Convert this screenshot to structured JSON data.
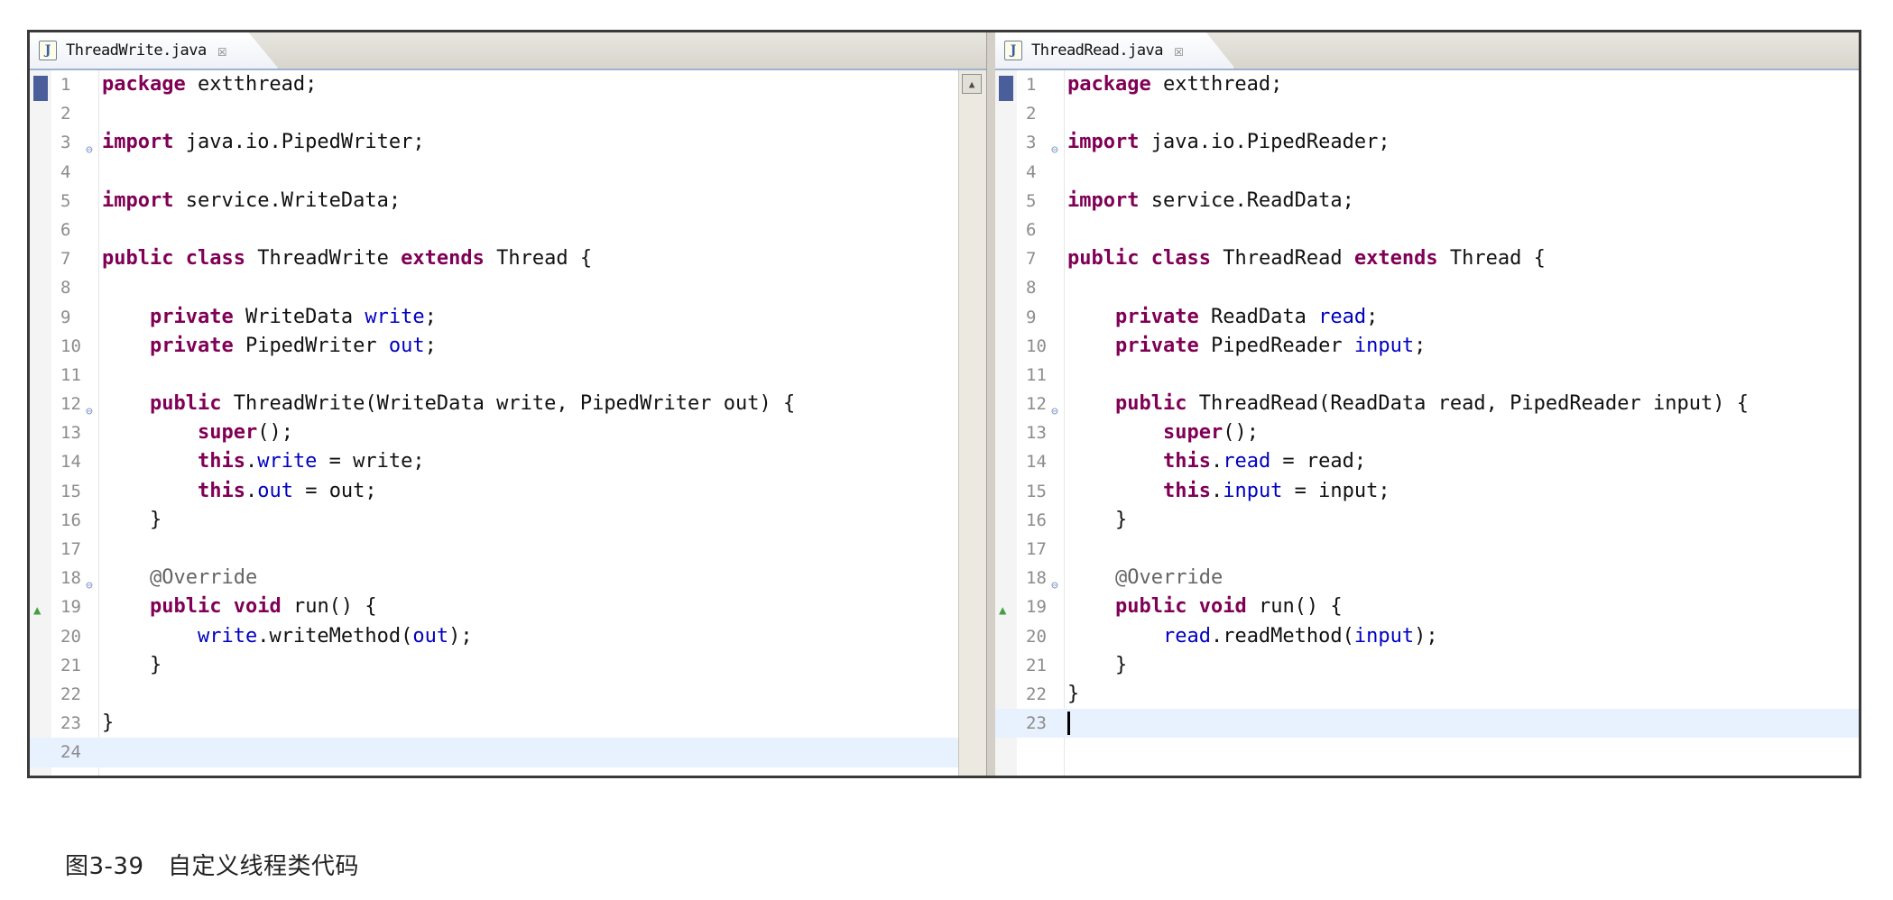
{
  "left_editor": {
    "tab_title": "ThreadWrite.java",
    "lines": [
      {
        "n": "1",
        "tokens": [
          {
            "t": "package",
            "c": "kw"
          },
          {
            "t": " extthread;"
          }
        ]
      },
      {
        "n": "2",
        "tokens": []
      },
      {
        "n": "3",
        "fold": true,
        "tokens": [
          {
            "t": "import",
            "c": "kw"
          },
          {
            "t": " java.io.PipedWriter;"
          }
        ]
      },
      {
        "n": "4",
        "tokens": []
      },
      {
        "n": "5",
        "tokens": [
          {
            "t": "import",
            "c": "kw"
          },
          {
            "t": " service.WriteData;"
          }
        ]
      },
      {
        "n": "6",
        "tokens": []
      },
      {
        "n": "7",
        "tokens": [
          {
            "t": "public",
            "c": "kw"
          },
          {
            "t": " "
          },
          {
            "t": "class",
            "c": "kw"
          },
          {
            "t": " ThreadWrite "
          },
          {
            "t": "extends",
            "c": "kw"
          },
          {
            "t": " Thread {"
          }
        ]
      },
      {
        "n": "8",
        "tokens": []
      },
      {
        "n": "9",
        "tokens": [
          {
            "t": "    "
          },
          {
            "t": "private",
            "c": "kw"
          },
          {
            "t": " WriteData "
          },
          {
            "t": "write",
            "c": "fld"
          },
          {
            "t": ";"
          }
        ]
      },
      {
        "n": "10",
        "tokens": [
          {
            "t": "    "
          },
          {
            "t": "private",
            "c": "kw"
          },
          {
            "t": " PipedWriter "
          },
          {
            "t": "out",
            "c": "fld"
          },
          {
            "t": ";"
          }
        ]
      },
      {
        "n": "11",
        "tokens": []
      },
      {
        "n": "12",
        "fold": true,
        "tokens": [
          {
            "t": "    "
          },
          {
            "t": "public",
            "c": "kw"
          },
          {
            "t": " ThreadWrite(WriteData write, PipedWriter out) {"
          }
        ]
      },
      {
        "n": "13",
        "tokens": [
          {
            "t": "        "
          },
          {
            "t": "super",
            "c": "kw"
          },
          {
            "t": "();"
          }
        ]
      },
      {
        "n": "14",
        "tokens": [
          {
            "t": "        "
          },
          {
            "t": "this",
            "c": "kw"
          },
          {
            "t": "."
          },
          {
            "t": "write",
            "c": "fld"
          },
          {
            "t": " = write;"
          }
        ]
      },
      {
        "n": "15",
        "tokens": [
          {
            "t": "        "
          },
          {
            "t": "this",
            "c": "kw"
          },
          {
            "t": "."
          },
          {
            "t": "out",
            "c": "fld"
          },
          {
            "t": " = out;"
          }
        ]
      },
      {
        "n": "16",
        "tokens": [
          {
            "t": "    }"
          }
        ]
      },
      {
        "n": "17",
        "tokens": []
      },
      {
        "n": "18",
        "fold": true,
        "tokens": [
          {
            "t": "    "
          },
          {
            "t": "@Override",
            "c": "ann"
          }
        ]
      },
      {
        "n": "19",
        "arrow": true,
        "tokens": [
          {
            "t": "    "
          },
          {
            "t": "public",
            "c": "kw"
          },
          {
            "t": " "
          },
          {
            "t": "void",
            "c": "kw"
          },
          {
            "t": " run() {"
          }
        ]
      },
      {
        "n": "20",
        "tokens": [
          {
            "t": "        "
          },
          {
            "t": "write",
            "c": "fld"
          },
          {
            "t": ".writeMethod("
          },
          {
            "t": "out",
            "c": "fld"
          },
          {
            "t": ");"
          }
        ]
      },
      {
        "n": "21",
        "tokens": [
          {
            "t": "    }"
          }
        ]
      },
      {
        "n": "22",
        "tokens": []
      },
      {
        "n": "23",
        "tokens": [
          {
            "t": "}"
          }
        ]
      },
      {
        "n": "24",
        "current": true,
        "tokens": []
      }
    ]
  },
  "right_editor": {
    "tab_title": "ThreadRead.java",
    "lines": [
      {
        "n": "1",
        "tokens": [
          {
            "t": "package",
            "c": "kw"
          },
          {
            "t": " extthread;"
          }
        ]
      },
      {
        "n": "2",
        "tokens": []
      },
      {
        "n": "3",
        "fold": true,
        "tokens": [
          {
            "t": "import",
            "c": "kw"
          },
          {
            "t": " java.io.PipedReader;"
          }
        ]
      },
      {
        "n": "4",
        "tokens": []
      },
      {
        "n": "5",
        "tokens": [
          {
            "t": "import",
            "c": "kw"
          },
          {
            "t": " service.ReadData;"
          }
        ]
      },
      {
        "n": "6",
        "tokens": []
      },
      {
        "n": "7",
        "tokens": [
          {
            "t": "public",
            "c": "kw"
          },
          {
            "t": " "
          },
          {
            "t": "class",
            "c": "kw"
          },
          {
            "t": " ThreadRead "
          },
          {
            "t": "extends",
            "c": "kw"
          },
          {
            "t": " Thread {"
          }
        ]
      },
      {
        "n": "8",
        "tokens": []
      },
      {
        "n": "9",
        "tokens": [
          {
            "t": "    "
          },
          {
            "t": "private",
            "c": "kw"
          },
          {
            "t": " ReadData "
          },
          {
            "t": "read",
            "c": "fld"
          },
          {
            "t": ";"
          }
        ]
      },
      {
        "n": "10",
        "tokens": [
          {
            "t": "    "
          },
          {
            "t": "private",
            "c": "kw"
          },
          {
            "t": " PipedReader "
          },
          {
            "t": "input",
            "c": "fld"
          },
          {
            "t": ";"
          }
        ]
      },
      {
        "n": "11",
        "tokens": []
      },
      {
        "n": "12",
        "fold": true,
        "tokens": [
          {
            "t": "    "
          },
          {
            "t": "public",
            "c": "kw"
          },
          {
            "t": " ThreadRead(ReadData read, PipedReader input) {"
          }
        ]
      },
      {
        "n": "13",
        "tokens": [
          {
            "t": "        "
          },
          {
            "t": "super",
            "c": "kw"
          },
          {
            "t": "();"
          }
        ]
      },
      {
        "n": "14",
        "tokens": [
          {
            "t": "        "
          },
          {
            "t": "this",
            "c": "kw"
          },
          {
            "t": "."
          },
          {
            "t": "read",
            "c": "fld"
          },
          {
            "t": " = read;"
          }
        ]
      },
      {
        "n": "15",
        "tokens": [
          {
            "t": "        "
          },
          {
            "t": "this",
            "c": "kw"
          },
          {
            "t": "."
          },
          {
            "t": "input",
            "c": "fld"
          },
          {
            "t": " = input;"
          }
        ]
      },
      {
        "n": "16",
        "tokens": [
          {
            "t": "    }"
          }
        ]
      },
      {
        "n": "17",
        "tokens": []
      },
      {
        "n": "18",
        "fold": true,
        "tokens": [
          {
            "t": "    "
          },
          {
            "t": "@Override",
            "c": "ann"
          }
        ]
      },
      {
        "n": "19",
        "arrow": true,
        "tokens": [
          {
            "t": "    "
          },
          {
            "t": "public",
            "c": "kw"
          },
          {
            "t": " "
          },
          {
            "t": "void",
            "c": "kw"
          },
          {
            "t": " run() {"
          }
        ]
      },
      {
        "n": "20",
        "tokens": [
          {
            "t": "        "
          },
          {
            "t": "read",
            "c": "fld"
          },
          {
            "t": ".readMethod("
          },
          {
            "t": "input",
            "c": "fld"
          },
          {
            "t": ");"
          }
        ]
      },
      {
        "n": "21",
        "tokens": [
          {
            "t": "    }"
          }
        ]
      },
      {
        "n": "22",
        "tokens": [
          {
            "t": "}"
          }
        ]
      },
      {
        "n": "23",
        "current": true,
        "caret": true,
        "tokens": []
      }
    ]
  },
  "caption": "图3-39　自定义线程类代码",
  "colors": {
    "keyword": "#7f0055",
    "field": "#0000c0",
    "annotation": "#646464",
    "current_line": "#e8f2fe"
  }
}
